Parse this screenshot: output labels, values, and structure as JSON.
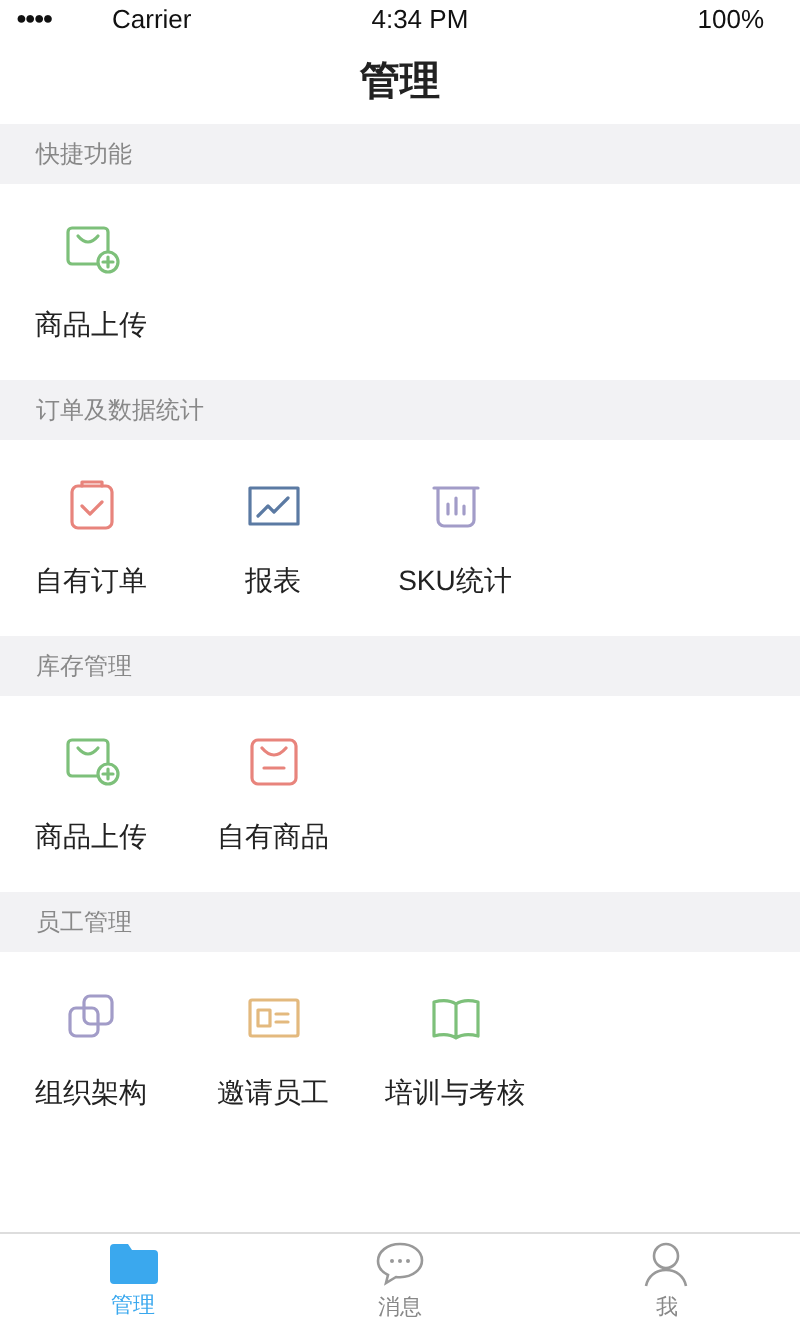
{
  "status_bar": {
    "signal": "●●●●",
    "carrier": "Carrier",
    "time": "4:34 PM",
    "battery": "100%"
  },
  "header": {
    "title": "管理"
  },
  "sections": [
    {
      "title": "快捷功能",
      "items": [
        {
          "label": "商品上传",
          "color": "#7dc07a"
        }
      ]
    },
    {
      "title": "订单及数据统计",
      "items": [
        {
          "label": "自有订单",
          "color": "#e8847c"
        },
        {
          "label": "报表",
          "color": "#5b7aa3"
        },
        {
          "label": "SKU统计",
          "color": "#a29cc8"
        }
      ]
    },
    {
      "title": "库存管理",
      "items": [
        {
          "label": "商品上传",
          "color": "#7dc07a"
        },
        {
          "label": "自有商品",
          "color": "#e8847c"
        }
      ]
    },
    {
      "title": "员工管理",
      "items": [
        {
          "label": "组织架构",
          "color": "#a29cc8"
        },
        {
          "label": "邀请员工",
          "color": "#e3b97e"
        },
        {
          "label": "培训与考核",
          "color": "#7dc07a"
        }
      ]
    }
  ],
  "tab_bar": [
    {
      "label": "管理",
      "selected": true
    },
    {
      "label": "消息",
      "selected": false
    },
    {
      "label": "我",
      "selected": false
    }
  ]
}
